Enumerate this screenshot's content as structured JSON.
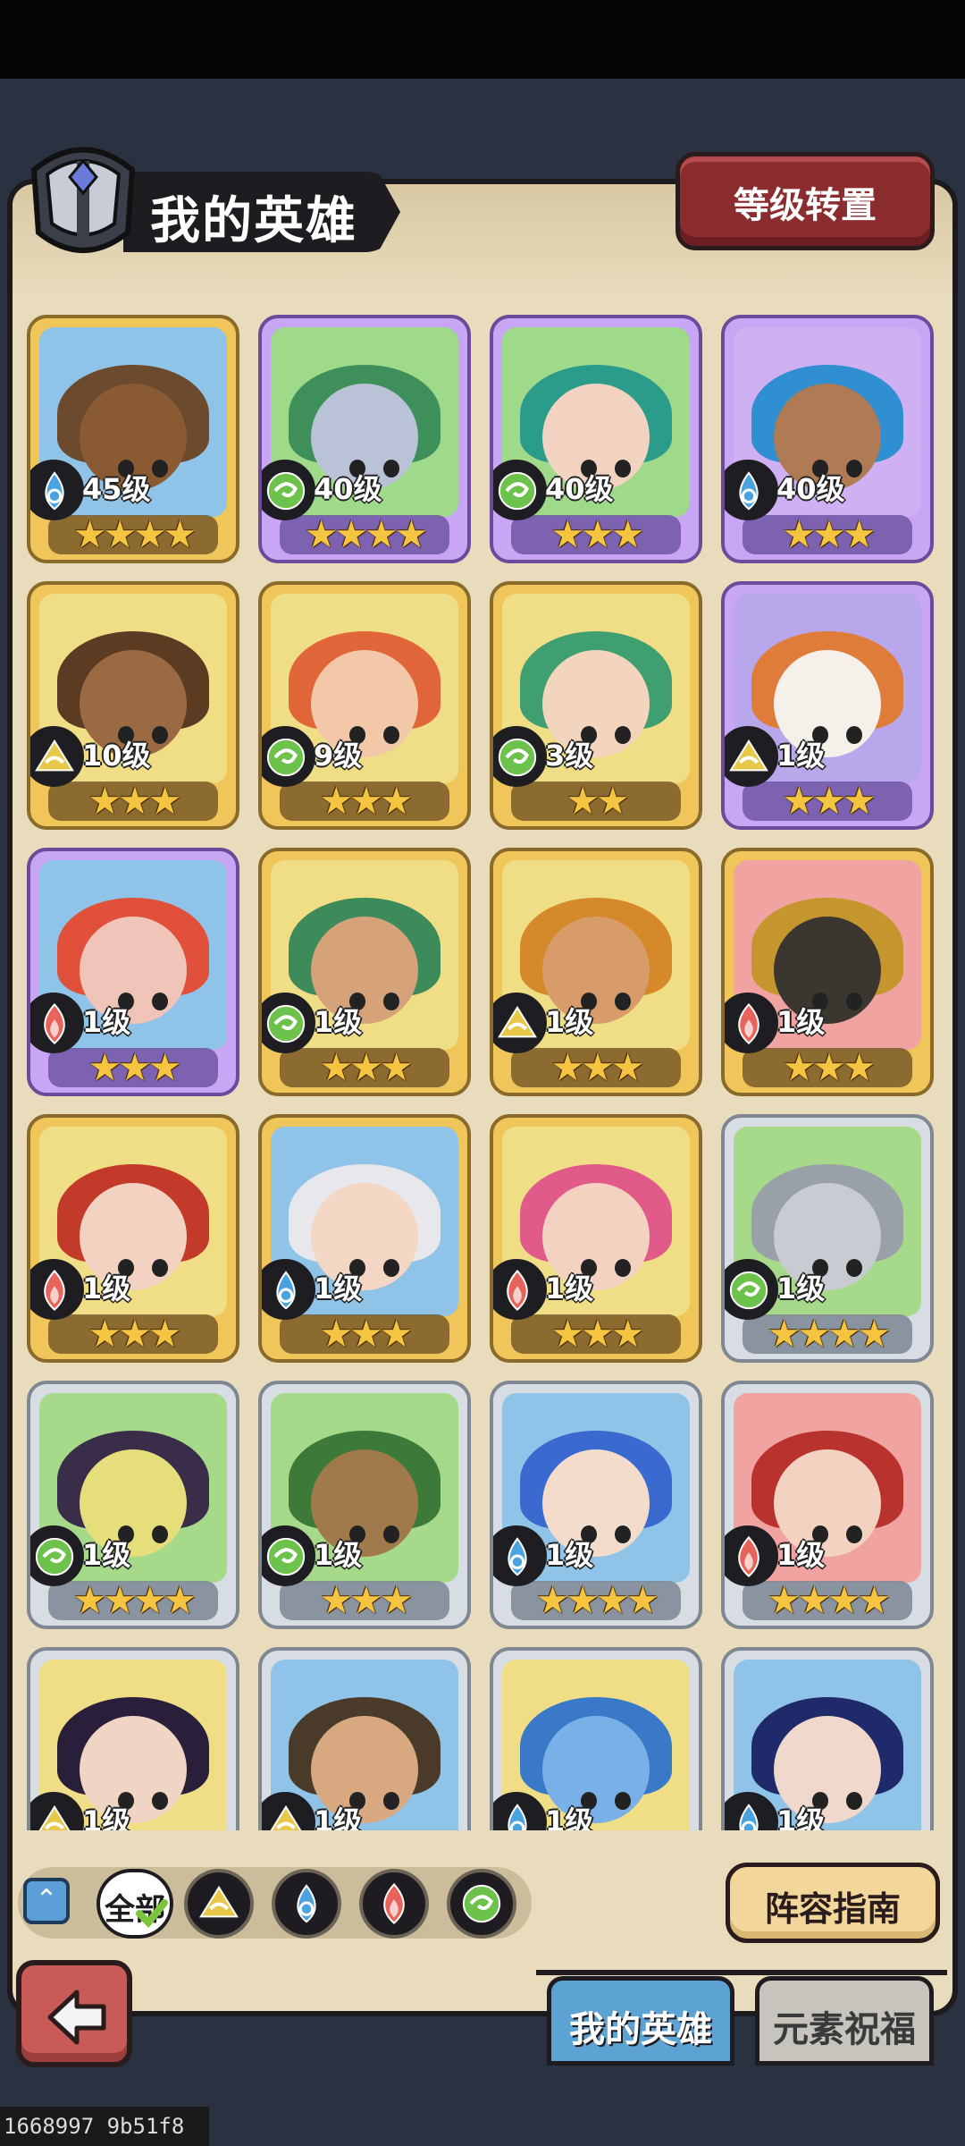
{
  "header": {
    "title": "我的英雄",
    "rank_button": "等级转置"
  },
  "heroes": [
    {
      "level": "45级",
      "stars": "★★★★",
      "element": "water",
      "frame": "gold",
      "bg": "#8fc4e8",
      "hair": "#6b4a2e",
      "face": "#8a5a33"
    },
    {
      "level": "40级",
      "stars": "★★★★",
      "element": "wind",
      "frame": "purple",
      "bg": "#9fd98a",
      "hair": "#3f8f5a",
      "face": "#b9c2d6"
    },
    {
      "level": "40级",
      "stars": "★★★",
      "element": "wind",
      "frame": "purple",
      "bg": "#9fd98a",
      "hair": "#2c9c8a",
      "face": "#f2d2c0"
    },
    {
      "level": "40级",
      "stars": "★★★",
      "element": "water",
      "frame": "purple",
      "bg": "#cfb0f2",
      "hair": "#2f8fd0",
      "face": "#b07a55"
    },
    {
      "level": "10级",
      "stars": "★★★",
      "element": "earth",
      "frame": "gold",
      "bg": "#f0de86",
      "hair": "#5c3b23",
      "face": "#9b6a42"
    },
    {
      "level": "9级",
      "stars": "★★★",
      "element": "wind",
      "frame": "gold",
      "bg": "#f0de86",
      "hair": "#e0663a",
      "face": "#f2c8a8"
    },
    {
      "level": "3级",
      "stars": "★★",
      "element": "wind",
      "frame": "gold",
      "bg": "#f0de86",
      "hair": "#3f9f70",
      "face": "#f3d4bd"
    },
    {
      "level": "1级",
      "stars": "★★★",
      "element": "earth",
      "frame": "purple",
      "bg": "#b9a7ec",
      "hair": "#e07c3a",
      "face": "#f5f0ea"
    },
    {
      "level": "1级",
      "stars": "★★★",
      "element": "fire",
      "frame": "purple",
      "bg": "#8fc4e8",
      "hair": "#e0503a",
      "face": "#f0c4b8"
    },
    {
      "level": "1级",
      "stars": "★★★",
      "element": "wind",
      "frame": "gold",
      "bg": "#f0de86",
      "hair": "#3d8a5a",
      "face": "#d6a27a"
    },
    {
      "level": "1级",
      "stars": "★★★",
      "element": "earth",
      "frame": "gold",
      "bg": "#f0de86",
      "hair": "#d6892a",
      "face": "#d89c6a"
    },
    {
      "level": "1级",
      "stars": "★★★",
      "element": "fire",
      "frame": "gold",
      "bg": "#f0a3a0",
      "hair": "#c6962e",
      "face": "#3b3730"
    },
    {
      "level": "1级",
      "stars": "★★★",
      "element": "fire",
      "frame": "gold",
      "bg": "#f0de86",
      "hair": "#c23a2a",
      "face": "#f4d2c2"
    },
    {
      "level": "1级",
      "stars": "★★★",
      "element": "water",
      "frame": "gold",
      "bg": "#8fc4e8",
      "hair": "#e8e8ec",
      "face": "#f4d6c4"
    },
    {
      "level": "1级",
      "stars": "★★★",
      "element": "fire",
      "frame": "gold",
      "bg": "#f0de86",
      "hair": "#e05a8a",
      "face": "#f4d2c2"
    },
    {
      "level": "1级",
      "stars": "★★★★",
      "element": "wind",
      "frame": "silver",
      "bg": "#a6d98a",
      "hair": "#9aa0a8",
      "face": "#c8ccd2"
    },
    {
      "level": "1级",
      "stars": "★★★★",
      "element": "wind",
      "frame": "silver",
      "bg": "#a6d98a",
      "hair": "#3a2d4a",
      "face": "#e6de7a"
    },
    {
      "level": "1级",
      "stars": "★★★",
      "element": "wind",
      "frame": "silver",
      "bg": "#a6d98a",
      "hair": "#3d7a3a",
      "face": "#a07a4a"
    },
    {
      "level": "1级",
      "stars": "★★★★",
      "element": "water",
      "frame": "silver",
      "bg": "#8fc4e8",
      "hair": "#3a6ad0",
      "face": "#f4dccc"
    },
    {
      "level": "1级",
      "stars": "★★★★",
      "element": "fire",
      "frame": "silver",
      "bg": "#f0a3a0",
      "hair": "#b8322e",
      "face": "#f4d2c2"
    },
    {
      "level": "1级",
      "stars": "★★★",
      "element": "earth",
      "frame": "silver",
      "bg": "#f0de86",
      "hair": "#2a1f3a",
      "face": "#f0d4c4"
    },
    {
      "level": "1级",
      "stars": "★★★",
      "element": "earth",
      "frame": "silver",
      "bg": "#8fc4e8",
      "hair": "#4a3a2a",
      "face": "#d8a880"
    },
    {
      "level": "1级",
      "stars": "★★★",
      "element": "water",
      "frame": "silver",
      "bg": "#f0de86",
      "hair": "#3a78c8",
      "face": "#7ab0e8"
    },
    {
      "level": "1级",
      "stars": "★★★",
      "element": "water",
      "frame": "silver",
      "bg": "#8fc4e8",
      "hair": "#1f2a6a",
      "face": "#f0d8cc"
    }
  ],
  "filter": {
    "all_label": "全部",
    "elements": [
      "earth",
      "water",
      "fire",
      "wind"
    ]
  },
  "guide_button": "阵容指南",
  "tabs": {
    "my_heroes": "我的英雄",
    "element_blessing": "元素祝福"
  },
  "colors": {
    "earth": "#e8c84a",
    "water": "#4aa3e0",
    "fire": "#e8645a",
    "wind": "#6cc24a"
  },
  "icons": {
    "back": "back-arrow-icon",
    "up": "chevron-up-icon",
    "helm": "helmet-icon"
  },
  "watermark": "1668997 9b51f8"
}
